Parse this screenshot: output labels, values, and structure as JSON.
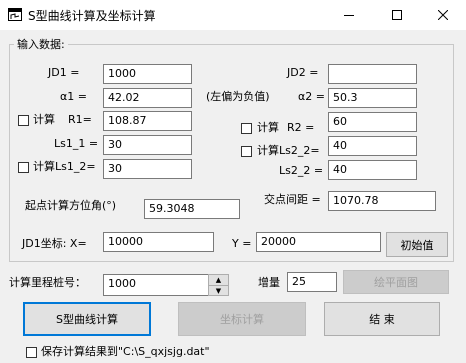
{
  "window": {
    "title": "S型曲线计算及坐标计算",
    "minimize": "—",
    "maximize": "☐",
    "close": "✕"
  },
  "group": {
    "legend": "输入数据:"
  },
  "jd1": {
    "label": "JD1 =",
    "value": "1000"
  },
  "jd2": {
    "label": "JD2 =",
    "value": ""
  },
  "a1": {
    "label": "α1 =",
    "value": "42.02"
  },
  "left_neg_note": "(左偏为负值)",
  "a2": {
    "label": "α2 =",
    "value": "50.3"
  },
  "r1": {
    "check_label": "计算",
    "label": "R1=",
    "value": "108.87"
  },
  "r2": {
    "check_label": "计算",
    "label": "R2 =",
    "value": "60"
  },
  "ls1_1": {
    "label": "Ls1_1 =",
    "value": "30"
  },
  "ls2_2_calc": {
    "check_label": "计算Ls2_2=",
    "value": "40"
  },
  "ls1_2": {
    "check_label": "计算Ls1_2=",
    "value": "30"
  },
  "ls2_2": {
    "label": "Ls2_2 =",
    "value": "40"
  },
  "start_azimuth": {
    "label": "起点计算方位角(°)",
    "value": "59.3048"
  },
  "jd_distance": {
    "label": "交点间距 =",
    "value": "1070.78"
  },
  "jd1_coord": {
    "label": "JD1坐标: X=",
    "x_value": "10000",
    "y_label": "Y =",
    "y_value": "20000"
  },
  "buttons": {
    "init": "初始值",
    "draw_plan": "绘平面图",
    "s_curve": "S型曲线计算",
    "coord_calc": "坐标计算",
    "end": "结  束"
  },
  "station": {
    "label": "计算里程桩号：",
    "value": "1000"
  },
  "increment": {
    "label": "增量",
    "value": "25"
  },
  "save": {
    "label": "保存计算结果到\"C:\\S_qxjsjg.dat\""
  }
}
